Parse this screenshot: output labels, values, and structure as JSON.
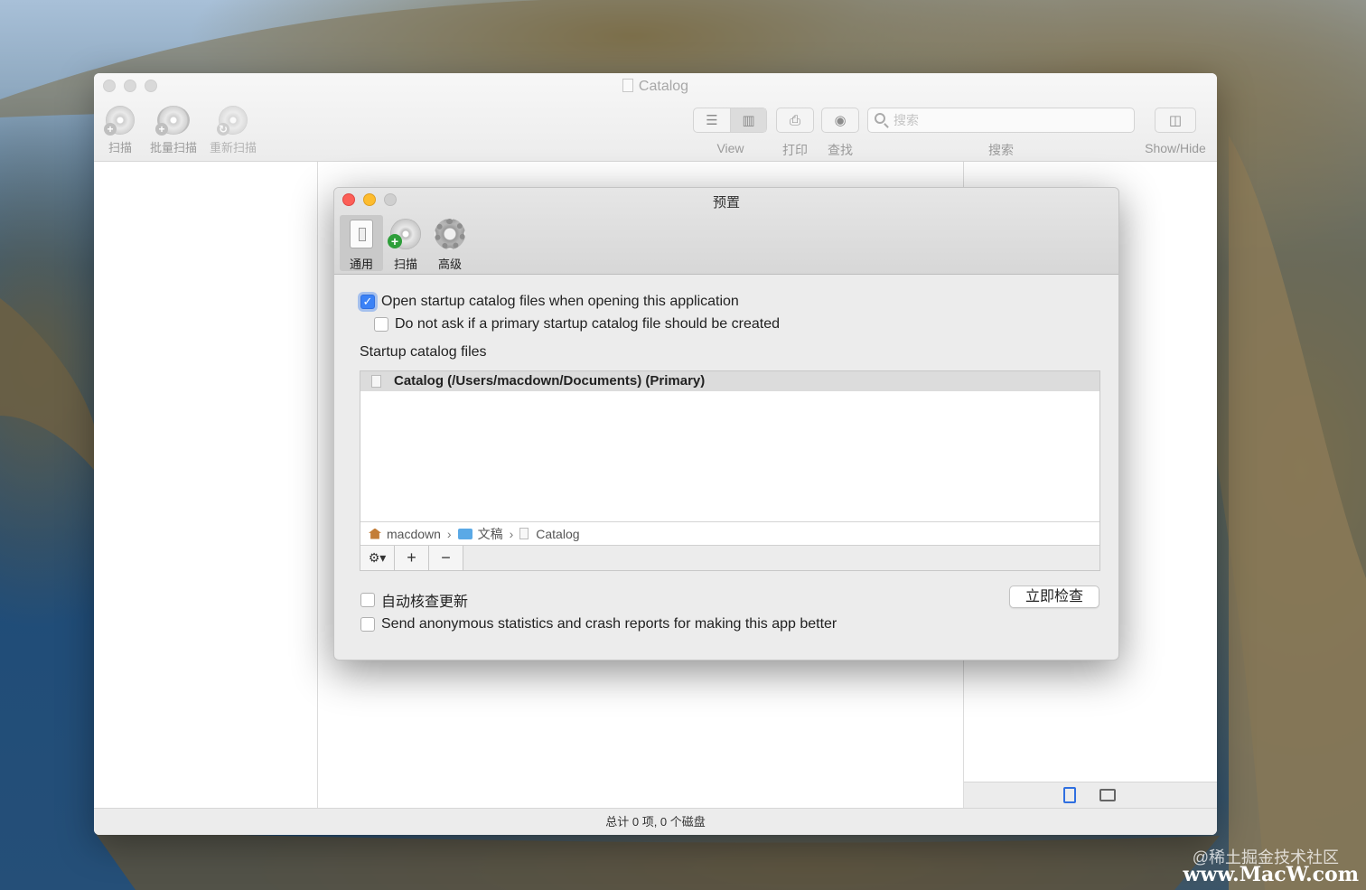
{
  "main_window": {
    "title": "Catalog",
    "toolbar": {
      "scan": "扫描",
      "batch_scan": "批量扫描",
      "rescan": "重新扫描",
      "view": "View",
      "print": "打印",
      "find": "查找",
      "search_caption": "搜索",
      "search_placeholder": "搜索",
      "show_hide": "Show/Hide"
    },
    "status": "总计 0 项, 0 个磁盘"
  },
  "prefs": {
    "title": "预置",
    "tabs": [
      {
        "label": "通用",
        "icon": "switch-icon",
        "active": true
      },
      {
        "label": "扫描",
        "icon": "disc-add-icon",
        "active": false
      },
      {
        "label": "高级",
        "icon": "gear-icon",
        "active": false
      }
    ],
    "open_startup": {
      "label": "Open startup catalog files when opening this application",
      "checked": true
    },
    "do_not_ask": {
      "label": "Do not ask if a primary startup catalog file should be created",
      "checked": false
    },
    "startup_label": "Startup catalog files",
    "catalog_entry": "Catalog (/Users/macdown/Documents) (Primary)",
    "path": [
      "macdown",
      "文稿",
      "Catalog"
    ],
    "auto_update": {
      "label": "自动核查更新",
      "checked": false
    },
    "check_now": "立即检查",
    "send_stats": {
      "label": "Send anonymous statistics and crash reports for making this app better",
      "checked": false
    }
  },
  "watermark": {
    "line1": "@稀土掘金技术社区",
    "line2": "www.MacW.com"
  }
}
